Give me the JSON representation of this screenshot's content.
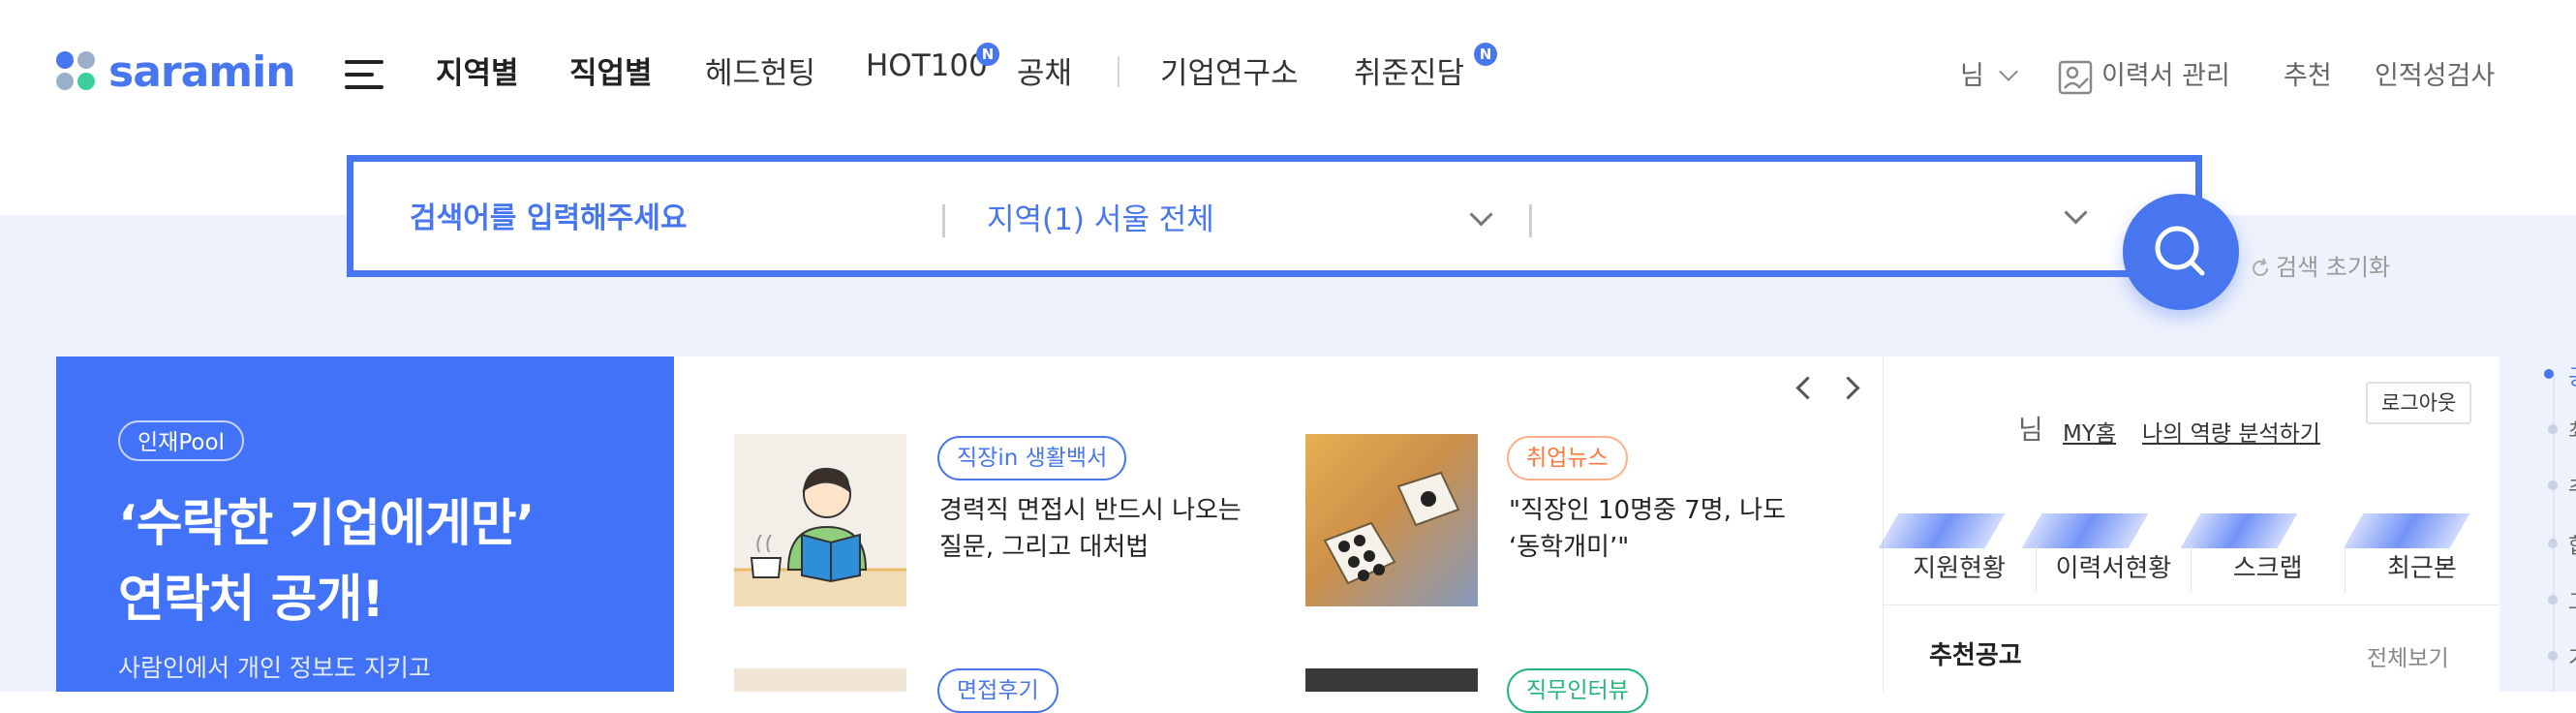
{
  "header": {
    "logo": "saramin",
    "nav": [
      {
        "label": "지역별",
        "bold": true
      },
      {
        "label": "직업별",
        "bold": true
      },
      {
        "label": "헤드헌팅",
        "bold": false
      },
      {
        "label": "HOT100",
        "bold": false,
        "badge": "N"
      },
      {
        "label": "공채",
        "bold": false
      },
      {
        "label": "기업연구소",
        "bold": false
      },
      {
        "label": "취준진담",
        "bold": false,
        "badge": "N"
      }
    ],
    "util": {
      "user_suffix": "님",
      "resume": "이력서 관리",
      "recommend": "추천",
      "aptitude": "인적성검사"
    }
  },
  "search": {
    "placeholder": "검색어를 입력해주세요",
    "region": "지역(1) 서울 전체",
    "second_filter": "",
    "reset_label": "검색 초기화"
  },
  "banner": {
    "chip": "인재Pool",
    "headline1": "‘수락한 기업에게만’",
    "headline2": "연락처 공개!",
    "sub": "사람인에서 개인 정보도 지키고"
  },
  "news": [
    {
      "tag": "직장in 생활백서",
      "tag_color": "#4876ef",
      "title": "경력직 면접시 반드시 나오는 질문, 그리고 대처법"
    },
    {
      "tag": "취업뉴스",
      "tag_color": "#ff7a3c",
      "title": "\"직장인 10명중 7명, 나도 ‘동학개미’\""
    },
    {
      "tag": "면접후기",
      "tag_color": "#4876ef",
      "title": ""
    },
    {
      "tag": "직무인터뷰",
      "tag_color": "#24b47e",
      "title": ""
    }
  ],
  "user_panel": {
    "name_suffix": "님",
    "my_home": "MY홈",
    "analysis": "나의 역량 분석하기",
    "logout": "로그아웃",
    "stats": [
      "지원현황",
      "이력서현황",
      "스크랩",
      "최근본"
    ],
    "rec_title": "추천공고",
    "rec_all": "전체보기"
  },
  "rail": [
    "공",
    "최",
    "추",
    "합",
    "그",
    "기"
  ],
  "colors": {
    "brand": "#4876ef",
    "banner": "#4272f7",
    "band": "#eef2fc"
  }
}
